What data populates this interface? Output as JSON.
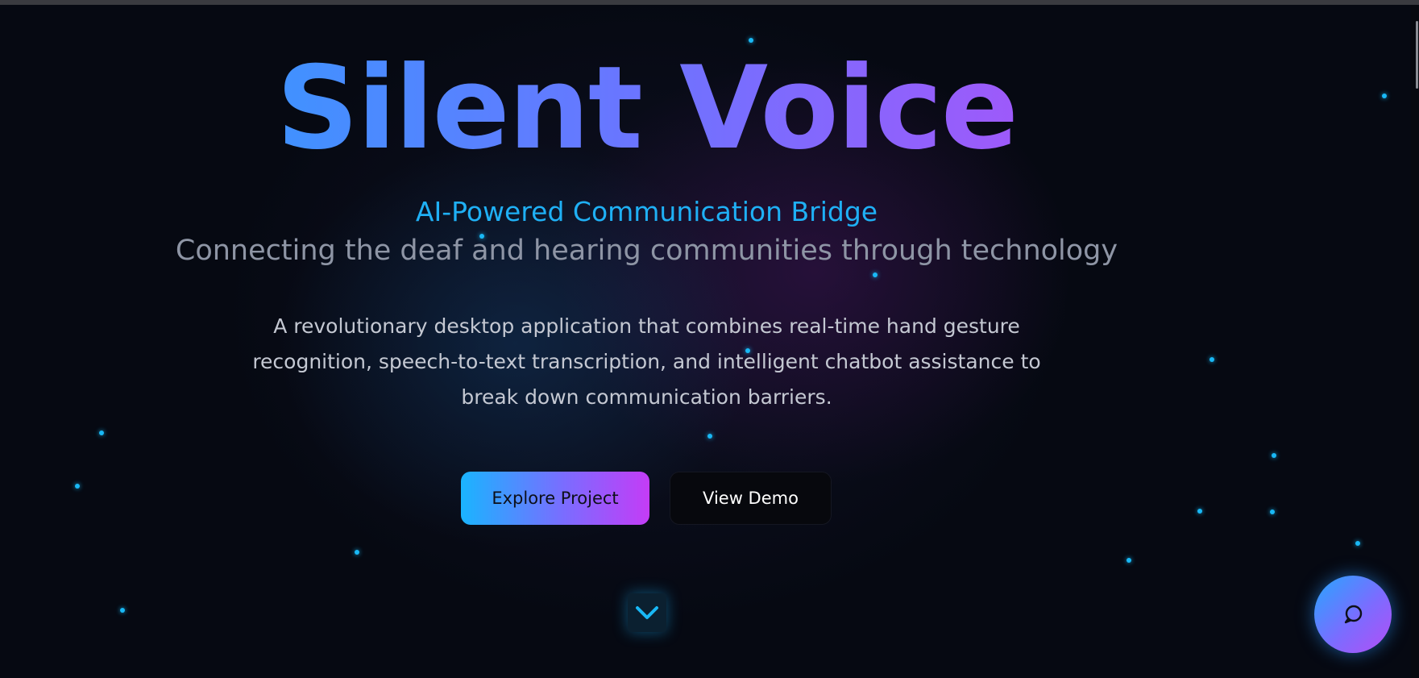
{
  "hero": {
    "title": "Silent Voice",
    "tagline": "AI-Powered Communication Bridge",
    "subtitle": "Connecting the deaf and hearing communities through technology",
    "description": "A revolutionary desktop application that combines real-time hand gesture recognition, speech-to-text transcription, and intelligent chatbot assistance to break down communication barriers."
  },
  "buttons": {
    "primary_label": "Explore Project",
    "secondary_label": "View Demo"
  },
  "icons": {
    "scroll_down": "chevron-down-icon",
    "chat": "chat-bubble-icon"
  },
  "colors": {
    "background": "#060912",
    "accent_blue": "#1fb0f5",
    "accent_purple": "#c346f7",
    "particle": "#19b8f5"
  }
}
